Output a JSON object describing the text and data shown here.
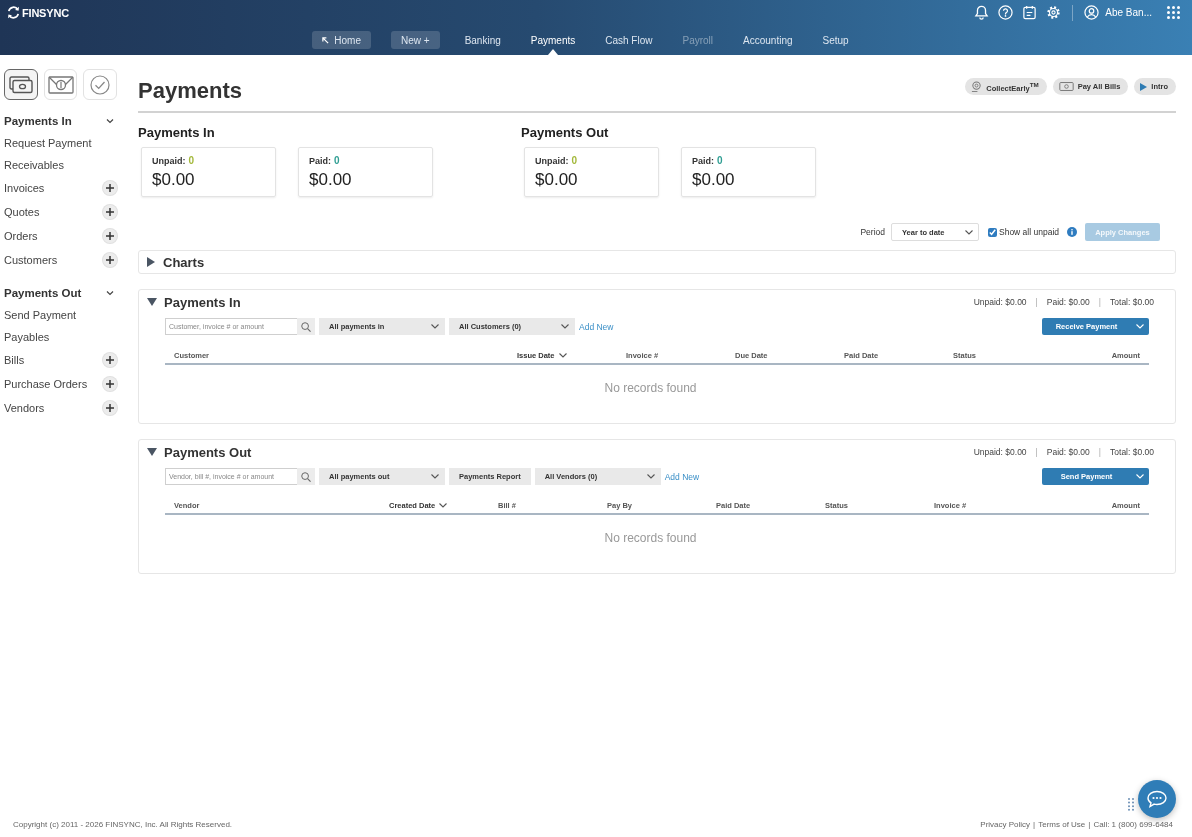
{
  "header": {
    "brand": "FINSYNC",
    "user": "Abe Ban...",
    "nav": [
      {
        "label": "Home",
        "kind": "shortcut",
        "selected": false,
        "disabled": false
      },
      {
        "label": "New +",
        "kind": "pill",
        "selected": false,
        "disabled": false
      },
      {
        "label": "Banking",
        "kind": "link",
        "selected": false,
        "disabled": false
      },
      {
        "label": "Payments",
        "kind": "link",
        "selected": true,
        "disabled": false
      },
      {
        "label": "Cash Flow",
        "kind": "link",
        "selected": false,
        "disabled": false
      },
      {
        "label": "Payroll",
        "kind": "link",
        "selected": false,
        "disabled": true
      },
      {
        "label": "Accounting",
        "kind": "link",
        "selected": false,
        "disabled": false
      },
      {
        "label": "Setup",
        "kind": "link",
        "selected": false,
        "disabled": false
      }
    ]
  },
  "sidebar": {
    "tabs": [
      {
        "selected": true
      },
      {
        "selected": false
      },
      {
        "selected": false
      }
    ],
    "groups": [
      {
        "title": "Payments In",
        "expanded": true,
        "items": [
          {
            "label": "Request Payment",
            "add": false
          },
          {
            "label": "Receivables",
            "add": false
          },
          {
            "label": "Invoices",
            "add": true
          },
          {
            "label": "Quotes",
            "add": true
          },
          {
            "label": "Orders",
            "add": true
          },
          {
            "label": "Customers",
            "add": true
          }
        ]
      },
      {
        "title": "Payments Out",
        "expanded": true,
        "items": [
          {
            "label": "Send Payment",
            "add": false
          },
          {
            "label": "Payables",
            "add": false
          },
          {
            "label": "Bills",
            "add": true
          },
          {
            "label": "Purchase Orders",
            "add": true
          },
          {
            "label": "Vendors",
            "add": true
          }
        ]
      }
    ]
  },
  "page": {
    "title": "Payments",
    "actions": [
      {
        "label": "CollectEarly$^{TM}$"
      },
      {
        "label": "Pay All Bills"
      },
      {
        "label": "Intro"
      }
    ]
  },
  "summaries": [
    {
      "title": "Payments In",
      "cards": [
        {
          "label": "Unpaid:",
          "count": "0",
          "color": "#a3b83a",
          "amount": "$0.00"
        },
        {
          "label": "Paid:",
          "count": "0",
          "color": "#2f9e93",
          "amount": "$0.00"
        }
      ]
    },
    {
      "title": "Payments Out",
      "cards": [
        {
          "label": "Unpaid:",
          "count": "0",
          "color": "#a3b83a",
          "amount": "$0.00"
        },
        {
          "label": "Paid:",
          "count": "0",
          "color": "#2f9e93",
          "amount": "$0.00"
        }
      ]
    }
  ],
  "filters": {
    "period_label": "Period",
    "period": "Year to date",
    "show_unpaid": {
      "label": "Show all unpaid",
      "checked": true
    },
    "apply": {
      "label": "Apply Changes",
      "disabled": true
    }
  },
  "charts": {
    "title": "Charts",
    "expanded": false
  },
  "panels": [
    {
      "title": "Payments In",
      "expanded": true,
      "totals": [
        {
          "kind": "total",
          "text": "Unpaid: $0.00"
        },
        {
          "kind": "separator",
          "text": "|"
        },
        {
          "kind": "total",
          "text": "Paid: $0.00"
        },
        {
          "kind": "separator",
          "text": "|"
        },
        {
          "kind": "total",
          "text": "Total: $0.00"
        }
      ],
      "search_placeholder": "Customer, invoice # or amount",
      "tools": [
        {
          "kind": "dropdown",
          "label": "All payments in"
        },
        {
          "kind": "dropdown",
          "label": "All Customers (0)"
        },
        {
          "kind": "link",
          "label": "Add New"
        }
      ],
      "action": "Receive Payment",
      "columns": [
        {
          "label": "Customer",
          "sorted": false
        },
        {
          "label": "Issue Date",
          "sorted": true
        },
        {
          "label": "Invoice #",
          "sorted": false
        },
        {
          "label": "Due Date",
          "sorted": false
        },
        {
          "label": "Paid Date",
          "sorted": false
        },
        {
          "label": "Status",
          "sorted": false
        },
        {
          "label": "Amount",
          "sorted": false
        }
      ],
      "empty": "No records found"
    },
    {
      "title": "Payments Out",
      "expanded": true,
      "totals": [
        {
          "kind": "total",
          "text": "Unpaid: $0.00"
        },
        {
          "kind": "separator",
          "text": "|"
        },
        {
          "kind": "total",
          "text": "Paid: $0.00"
        },
        {
          "kind": "separator",
          "text": "|"
        },
        {
          "kind": "total",
          "text": "Total: $0.00"
        }
      ],
      "search_placeholder": "Vendor, bill #, invoice # or amount",
      "tools": [
        {
          "kind": "dropdown",
          "label": "All payments out"
        },
        {
          "kind": "button",
          "label": "Payments Report"
        },
        {
          "kind": "dropdown",
          "label": "All Vendors (0)"
        },
        {
          "kind": "link",
          "label": "Add New"
        }
      ],
      "action": "Send Payment",
      "columns": [
        {
          "label": "Vendor",
          "sorted": false
        },
        {
          "label": "Created Date",
          "sorted": true
        },
        {
          "label": "Bill #",
          "sorted": false
        },
        {
          "label": "Pay By",
          "sorted": false
        },
        {
          "label": "Paid Date",
          "sorted": false
        },
        {
          "label": "Status",
          "sorted": false
        },
        {
          "label": "Invoice #",
          "sorted": false
        },
        {
          "label": "Amount",
          "sorted": false
        }
      ],
      "empty": "No records found"
    }
  ],
  "footer": {
    "copyright": "Copyright (c) 2011 - 2026 FINSYNC, Inc. All Rights Reserved.",
    "links": [
      "Privacy Policy",
      "|",
      "Terms of Use",
      "|",
      "Call: 1 (800) 699-6484"
    ]
  }
}
